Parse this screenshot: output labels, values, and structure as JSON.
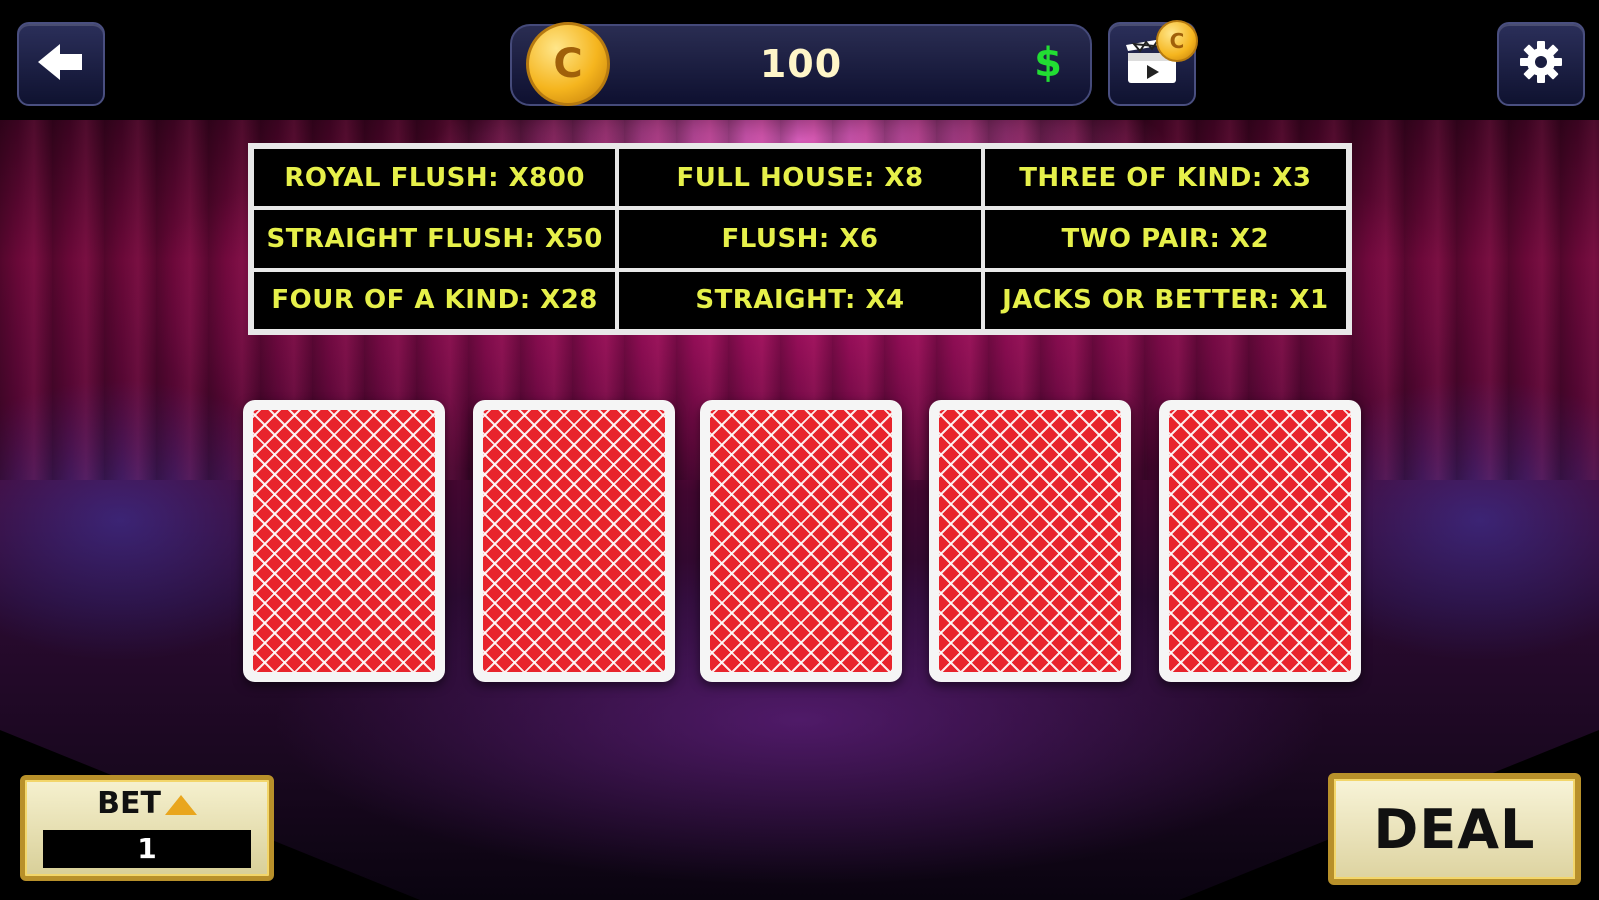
{
  "header": {
    "coin_symbol": "C",
    "balance": "100",
    "currency_symbol": "$",
    "icons": {
      "back": "back-arrow-icon",
      "video_reward": "video-reward-icon",
      "settings": "gear-icon"
    }
  },
  "paytable": {
    "rows": [
      [
        "ROYAL FLUSH: X800",
        "FULL HOUSE: X8",
        "THREE OF KIND: X3"
      ],
      [
        "STRAIGHT FLUSH: X50",
        "FLUSH: X6",
        "TWO PAIR: X2"
      ],
      [
        "FOUR OF A KIND: X28",
        "STRAIGHT: X4",
        "JACKS OR BETTER: X1"
      ]
    ],
    "text_color": "#e6f04a"
  },
  "hand": {
    "card_count": 5,
    "face": "back",
    "back_color": "#e8242c"
  },
  "controls": {
    "bet_label": "BET",
    "bet_value": "1",
    "deal_label": "DEAL"
  },
  "colors": {
    "button_gold": "#b8902a",
    "coin_gold": "#f5b51e",
    "currency_green": "#22dd33"
  }
}
